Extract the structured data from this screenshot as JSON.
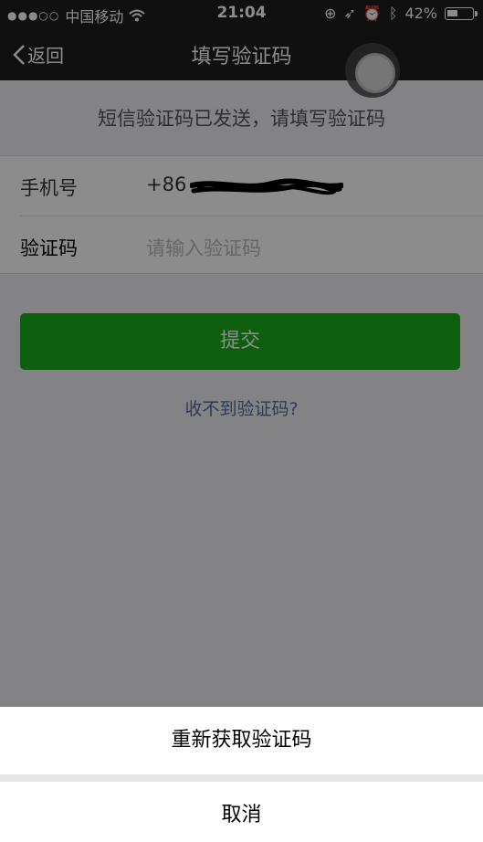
{
  "status_bar": {
    "signal_dots": "●●●○○",
    "carrier": "中国移动",
    "wifi_icon": "wifi-icon",
    "time": "21:04",
    "battery_percent": "42%",
    "battery_level": 0.42
  },
  "nav": {
    "back_label": "返回",
    "title": "填写验证码"
  },
  "notice": "短信验证码已发送，请填写验证码",
  "form": {
    "phone_label": "手机号",
    "phone_prefix": "+86",
    "code_label": "验证码",
    "code_placeholder": "请输入验证码"
  },
  "submit_label": "提交",
  "help_link": "收不到验证码?",
  "action_sheet": {
    "resend_label": "重新获取验证码",
    "cancel_label": "取消"
  },
  "colors": {
    "accent_green": "#1aad19",
    "link_blue": "#576b95",
    "nav_bg": "#1e1e1e"
  }
}
